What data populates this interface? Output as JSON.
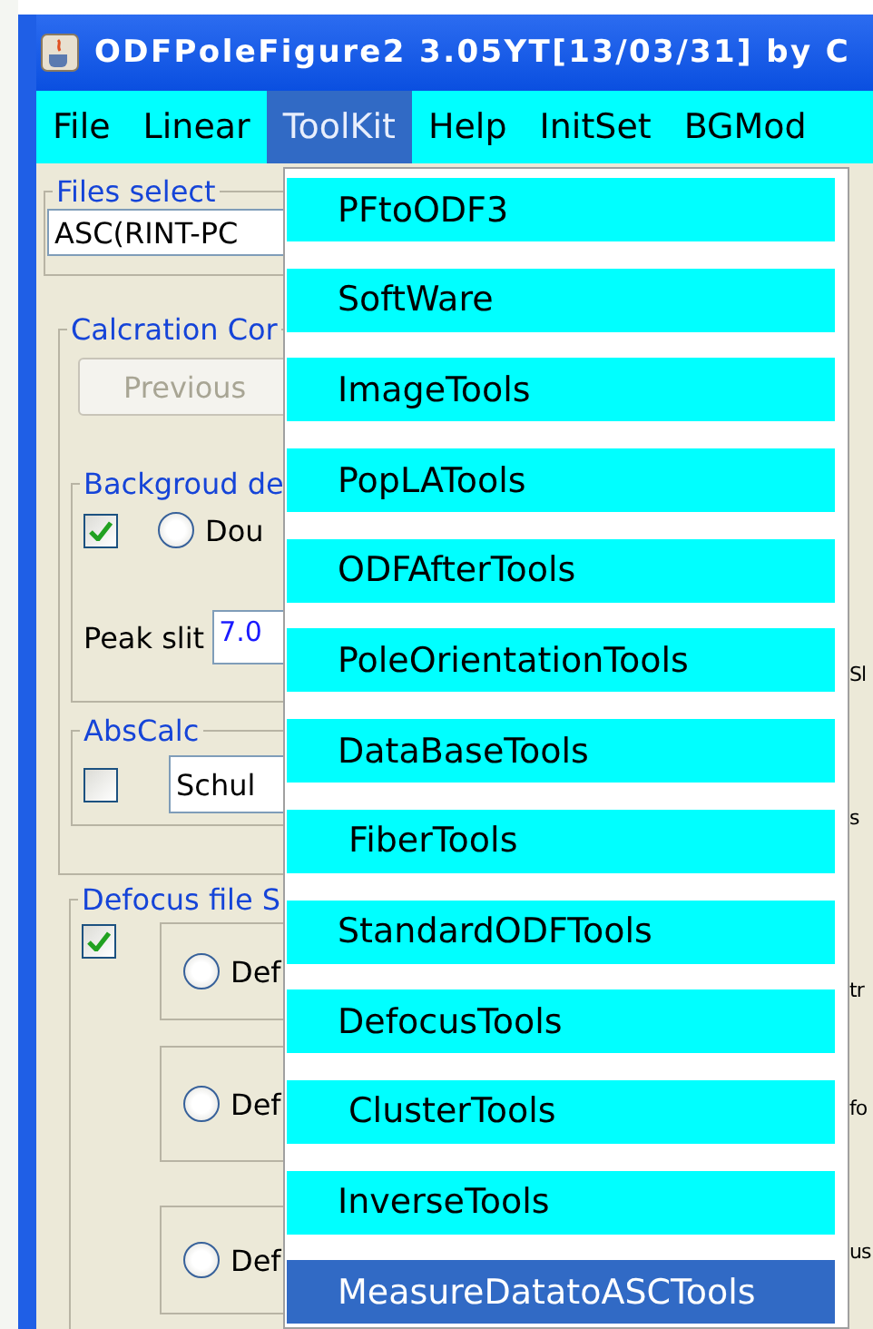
{
  "window": {
    "title": "ODFPoleFigure2 3.05YT[13/03/31] by C"
  },
  "menu_bar": [
    {
      "label": "File",
      "selected": false
    },
    {
      "label": "Linear",
      "selected": false
    },
    {
      "label": "ToolKit",
      "selected": true
    },
    {
      "label": "Help",
      "selected": false
    },
    {
      "label": "InitSet",
      "selected": false
    },
    {
      "label": "BGMod",
      "selected": false
    }
  ],
  "dropdown": [
    {
      "label": "PFtoODF3",
      "selected": false
    },
    {
      "label": "SoftWare",
      "selected": false
    },
    {
      "label": "ImageTools",
      "selected": false
    },
    {
      "label": "PopLATools",
      "selected": false
    },
    {
      "label": "ODFAfterTools",
      "selected": false
    },
    {
      "label": "PoleOrientationTools",
      "selected": false
    },
    {
      "label": "DataBaseTools",
      "selected": false
    },
    {
      "label": " FiberTools",
      "selected": false
    },
    {
      "label": "StandardODFTools",
      "selected": false
    },
    {
      "label": "DefocusTools",
      "selected": false
    },
    {
      "label": " ClusterTools",
      "selected": false
    },
    {
      "label": "InverseTools",
      "selected": false
    },
    {
      "label": "MeasureDatatoASCTools",
      "selected": true
    }
  ],
  "files_select": {
    "label": "Files select",
    "value": "ASC(RINT-PC"
  },
  "calculation": {
    "label": "Calcration Cor",
    "button": {
      "label": "Previous",
      "disabled": true
    }
  },
  "background": {
    "label": "Backgroud de",
    "checked": true,
    "radio": {
      "label": "Dou",
      "selected": false
    },
    "peak_slit": {
      "label": "Peak slit",
      "value": "7.0"
    }
  },
  "abs_calc": {
    "label": "AbsCalc",
    "checked": false,
    "value": "Schul"
  },
  "defocus": {
    "label": "Defocus file S",
    "checked": true,
    "options": [
      {
        "label": "Def",
        "selected": false
      },
      {
        "label": "Def",
        "selected": false
      },
      {
        "label": "Def",
        "selected": false
      }
    ]
  },
  "right_edge": [
    "Sl",
    "s",
    "tr",
    "fo",
    "us"
  ]
}
